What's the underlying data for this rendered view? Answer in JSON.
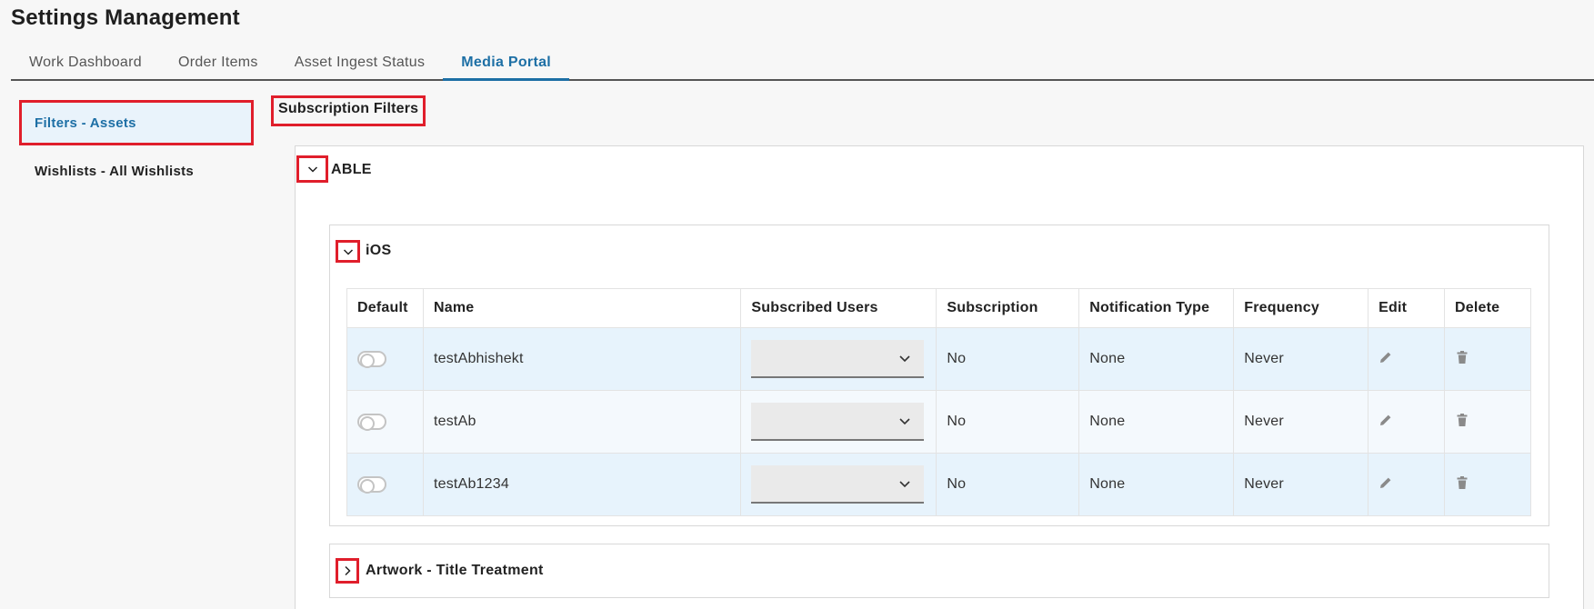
{
  "page": {
    "title": "Settings Management"
  },
  "tabs": [
    {
      "label": "Work Dashboard"
    },
    {
      "label": "Order Items"
    },
    {
      "label": "Asset Ingest Status"
    },
    {
      "label": "Media Portal"
    }
  ],
  "active_tab": "Media Portal",
  "sidebar": {
    "items": [
      {
        "label": "Filters - Assets"
      },
      {
        "label": "Wishlists - All Wishlists"
      }
    ]
  },
  "section": {
    "title": "Subscription Filters"
  },
  "groups": {
    "outer": {
      "label": "ABLE",
      "expanded": true
    },
    "ios": {
      "label": "iOS",
      "expanded": true
    },
    "artwork": {
      "label": "Artwork - Title Treatment",
      "expanded": false
    }
  },
  "table": {
    "headers": {
      "default": "Default",
      "name": "Name",
      "subscribed_users": "Subscribed Users",
      "subscription": "Subscription",
      "notification_type": "Notification Type",
      "frequency": "Frequency",
      "edit": "Edit",
      "delete": "Delete"
    },
    "rows": [
      {
        "default": false,
        "name": "testAbhishekt",
        "subscribed_users": "",
        "subscription": "No",
        "notification_type": "None",
        "frequency": "Never"
      },
      {
        "default": false,
        "name": "testAb",
        "subscribed_users": "",
        "subscription": "No",
        "notification_type": "None",
        "frequency": "Never"
      },
      {
        "default": false,
        "name": "testAb1234",
        "subscribed_users": "",
        "subscription": "No",
        "notification_type": "None",
        "frequency": "Never"
      }
    ]
  },
  "icons": {
    "collapse": "chevron-down-icon",
    "expand": "chevron-right-icon",
    "dropdown": "chevron-down-icon",
    "edit": "pencil-icon",
    "delete": "trash-icon"
  },
  "colors": {
    "accent": "#1d6fa5",
    "highlight_outline": "#e01e2b",
    "row_stripe_a": "#e7f3fc",
    "row_stripe_b": "#f4f9fd",
    "icon_gray": "#8a8a8a"
  }
}
